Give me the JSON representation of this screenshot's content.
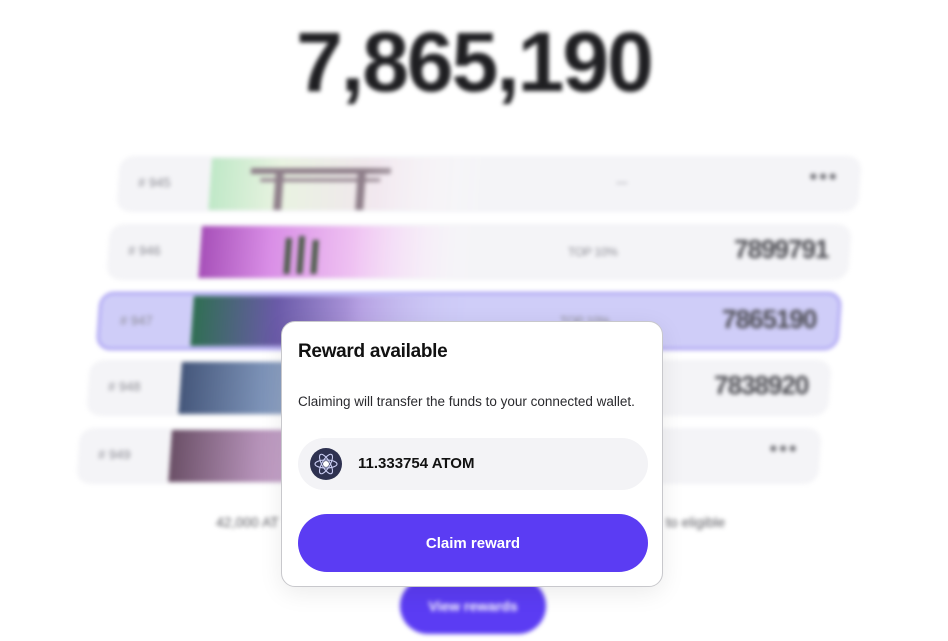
{
  "header": {
    "total_score": "7,865,190"
  },
  "leaderboard": {
    "rows": [
      {
        "rank": "# 945",
        "tier": "---",
        "score": "",
        "more": "•••"
      },
      {
        "rank": "# 946",
        "tier": "TOP 10%",
        "score": "7899791",
        "more": ""
      },
      {
        "rank": "# 947",
        "tier": "TOP 10%",
        "score": "7865190",
        "more": ""
      },
      {
        "rank": "# 948",
        "tier": "",
        "score": "7838920",
        "more": ""
      },
      {
        "rank": "# 949",
        "tier": "",
        "score": "",
        "more": "•••"
      }
    ]
  },
  "footer": {
    "info_left": "42,000 AT",
    "info_right": "to eligible",
    "view_rewards_label": "View rewards"
  },
  "modal": {
    "title": "Reward available",
    "description": "Claiming will transfer the funds to your connected wallet.",
    "token_icon": "cosmos-atom-icon",
    "amount": "11.333754 ATOM",
    "claim_label": "Claim reward"
  },
  "colors": {
    "accent": "#5b3cf3",
    "highlight_row": "#cfcdf8",
    "highlight_border": "#9a8ff1",
    "row_bg": "#f4f4f7",
    "token_icon_bg": "#2e3150"
  }
}
